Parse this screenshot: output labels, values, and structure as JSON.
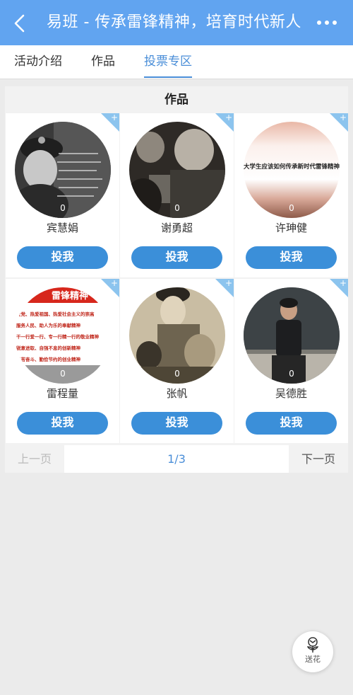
{
  "header": {
    "title": "易班 - 传承雷锋精神，培育时代新人",
    "back_icon": "chevron-left-icon",
    "more_icon": "more-dots-icon"
  },
  "tabs": [
    {
      "label": "活动介绍",
      "active": false
    },
    {
      "label": "作品",
      "active": false
    },
    {
      "label": "投票专区",
      "active": true
    }
  ],
  "panel": {
    "title": "作品"
  },
  "cards": [
    {
      "name": "宾慧娟",
      "likes": "0",
      "vote_label": "投我",
      "image": "black-and-white portrait of Lei Feng with handwritten text"
    },
    {
      "name": "谢勇超",
      "likes": "0",
      "vote_label": "投我",
      "image": "black-and-white photo of smiling soldiers"
    },
    {
      "name": "许珅健",
      "likes": "0",
      "vote_label": "投我",
      "image": "text graphic",
      "image_text": "大学生应该如何传承新时代雷锋精神"
    },
    {
      "name": "雷程量",
      "likes": "0",
      "vote_label": "投我",
      "image": "red slogan poster",
      "image_text": [
        "雷锋精神",
        "爱党、热爱祖国、热爱社会主义的崇高",
        "服务人民、助人为乐的奉献精神",
        "干一行爱一行、专一行精一行的敬业精神",
        "锐意进取、自强不息的创新精神",
        "艰苦奋斗、勤俭节约的创业精神"
      ]
    },
    {
      "name": "张帆",
      "likes": "0",
      "vote_label": "投我",
      "image": "sepia photo of soldier with children"
    },
    {
      "name": "吴德胜",
      "likes": "0",
      "vote_label": "投我",
      "image": "photo of student in front of blackboard"
    }
  ],
  "pagination": {
    "prev_label": "上一页",
    "page": "1/3",
    "next_label": "下一页"
  },
  "gift_button": {
    "label": "送花",
    "icon": "flower-icon"
  },
  "colors": {
    "header": "#61a4f0",
    "accent": "#4a8ed8",
    "vote_button": "#3b8fd9",
    "corner_badge": "#8cc4ee"
  }
}
